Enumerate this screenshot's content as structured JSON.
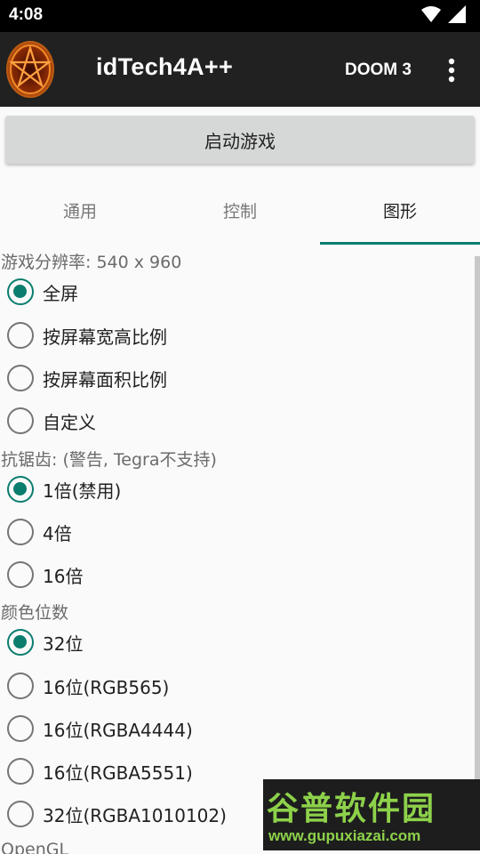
{
  "status_bar": {
    "time": "4:08",
    "icons": [
      "wifi-icon",
      "cell-signal-icon"
    ]
  },
  "app_bar": {
    "title": "idTech4A++",
    "game": "DOOM 3",
    "icons": [
      "pentagram-logo",
      "more-vert-icon"
    ]
  },
  "start_button": {
    "label": "启动游戏"
  },
  "tabs": [
    {
      "label": "通用",
      "selected": false
    },
    {
      "label": "控制",
      "selected": false
    },
    {
      "label": "图形",
      "selected": true
    }
  ],
  "sections": {
    "resolution": {
      "title": "游戏分辨率:  540 x 960",
      "options": [
        {
          "label": "全屏",
          "checked": true
        },
        {
          "label": "按屏幕宽高比例",
          "checked": false
        },
        {
          "label": "按屏幕面积比例",
          "checked": false
        },
        {
          "label": "自定义",
          "checked": false
        }
      ]
    },
    "antialias": {
      "title": "抗锯齿: (警告, Tegra不支持)",
      "options": [
        {
          "label": "1倍(禁用)",
          "checked": true
        },
        {
          "label": "4倍",
          "checked": false
        },
        {
          "label": "16倍",
          "checked": false
        }
      ]
    },
    "color_depth": {
      "title": "颜色位数",
      "options": [
        {
          "label": "32位",
          "checked": true
        },
        {
          "label": "16位(RGB565)",
          "checked": false
        },
        {
          "label": "16位(RGBA4444)",
          "checked": false
        },
        {
          "label": "16位(RGBA5551)",
          "checked": false
        },
        {
          "label": "32位(RGBA1010102)",
          "checked": false
        }
      ]
    },
    "opengl": {
      "title": "OpenGL"
    }
  },
  "watermark": {
    "brand": "谷普软件园",
    "url": "www.gupuxiazai.com"
  },
  "colors": {
    "accent": "#0a7d6e",
    "app_bar": "#212121",
    "status_bar": "#000000",
    "background": "#fafafa"
  }
}
